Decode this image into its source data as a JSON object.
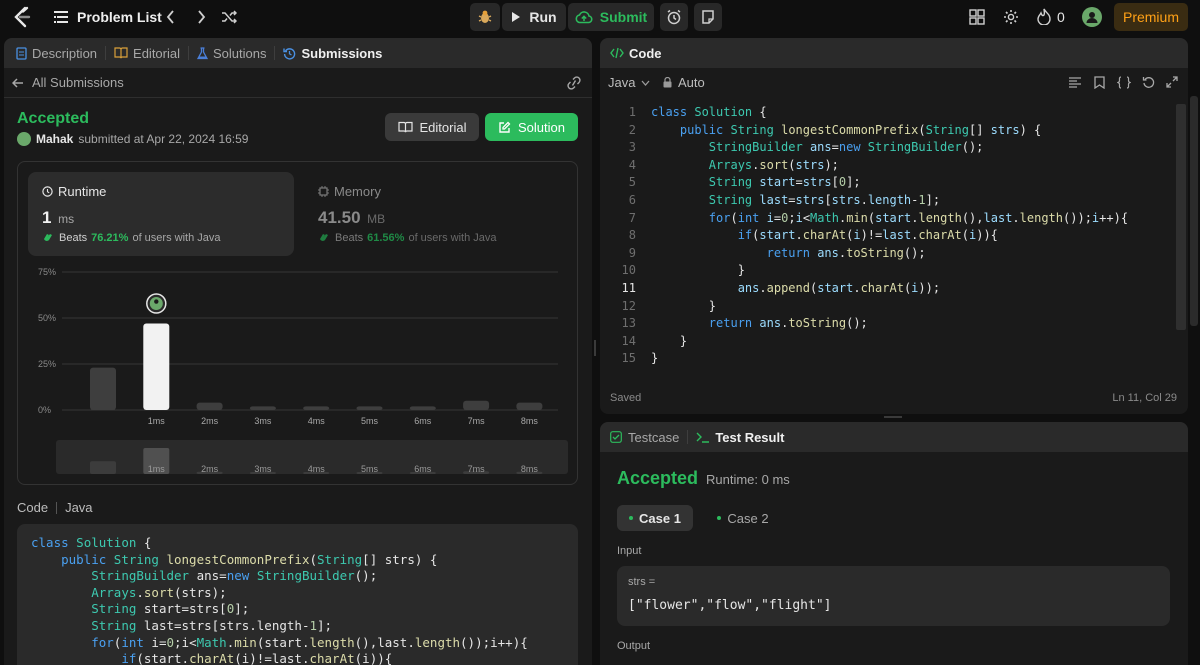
{
  "topbar": {
    "problem_list": "Problem List",
    "run": "Run",
    "submit": "Submit",
    "streak_count": "0",
    "premium": "Premium"
  },
  "left": {
    "tabs": [
      {
        "label": "Description"
      },
      {
        "label": "Editorial"
      },
      {
        "label": "Solutions"
      },
      {
        "label": "Submissions"
      }
    ],
    "back_label": "All Submissions",
    "status": "Accepted",
    "user": "Mahak",
    "submitted_text": "submitted at Apr 22, 2024 16:59",
    "editorial_btn": "Editorial",
    "solution_btn": "Solution",
    "runtime": {
      "title": "Runtime",
      "value": "1",
      "unit": "ms",
      "beats_prefix": "Beats",
      "beats_pct": "76.21%",
      "beats_suffix": "of users with Java"
    },
    "memory": {
      "title": "Memory",
      "value": "41.50",
      "unit": "MB",
      "beats_prefix": "Beats",
      "beats_pct": "61.56%",
      "beats_suffix": "of users with Java"
    },
    "code_label": "Code",
    "lang_label": "Java"
  },
  "chart_data": {
    "type": "bar",
    "categories": [
      "",
      "1ms",
      "2ms",
      "3ms",
      "4ms",
      "5ms",
      "6ms",
      "7ms",
      "8ms"
    ],
    "values": [
      23,
      47,
      4,
      2,
      2,
      2,
      2,
      5,
      4
    ],
    "highlight_index": 1,
    "y_ticks": [
      "75%",
      "50%",
      "25%",
      "0%"
    ],
    "ylim": [
      0,
      75
    ],
    "mini_labels": [
      "",
      "1ms",
      "2ms",
      "3ms",
      "4ms",
      "5ms",
      "6ms",
      "7ms",
      "8ms"
    ]
  },
  "editor": {
    "title": "Code",
    "language": "Java",
    "auto": "Auto",
    "saved": "Saved",
    "cursor": "Ln 11, Col 29",
    "current_line": 11
  },
  "test": {
    "tab_testcase": "Testcase",
    "tab_result": "Test Result",
    "status": "Accepted",
    "runtime": "Runtime: 0 ms",
    "case1": "Case 1",
    "case2": "Case 2",
    "input_label": "Input",
    "var_label": "strs =",
    "var_value": "[\"flower\",\"flow\",\"flight\"]",
    "output_label": "Output"
  }
}
